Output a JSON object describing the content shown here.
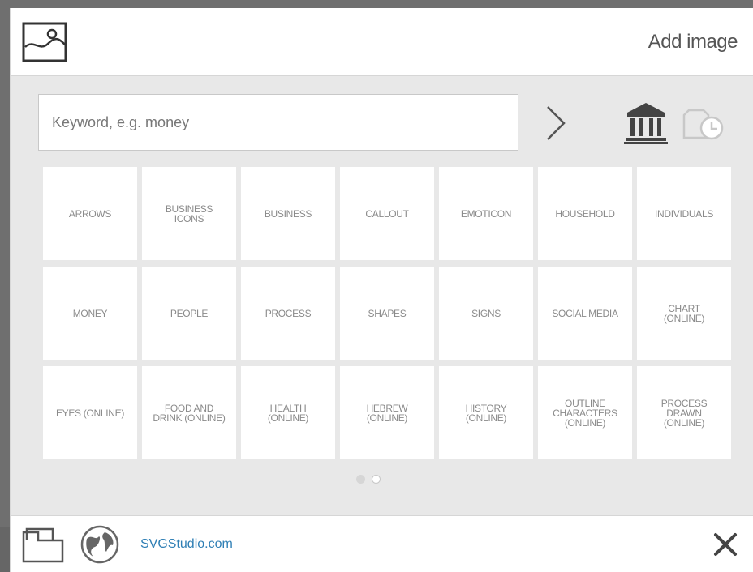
{
  "header": {
    "title": "Add image",
    "image_icon": "image-icon"
  },
  "search": {
    "placeholder": "Keyword, e.g. money",
    "value": ""
  },
  "toolbar": {
    "go_icon": "chevron-right-icon",
    "library_icon": "bank-icon",
    "history_icon": "history-icon"
  },
  "categories": [
    "ARROWS",
    "BUSINESS\nICONS",
    "BUSINESS",
    "CALLOUT",
    "EMOTICON",
    "HOUSEHOLD",
    "INDIVIDUALS",
    "MONEY",
    "PEOPLE",
    "PROCESS",
    "SHAPES",
    "SIGNS",
    "SOCIAL MEDIA",
    "CHART\n(ONLINE)",
    "EYES (ONLINE)",
    "FOOD AND\nDRINK (ONLINE)",
    "HEALTH\n(ONLINE)",
    "HEBREW\n(ONLINE)",
    "HISTORY\n(ONLINE)",
    "OUTLINE\nCHARACTERS\n(ONLINE)",
    "PROCESS\nDRAWN\n(ONLINE)"
  ],
  "pagination": {
    "current": 1,
    "total": 2
  },
  "footer": {
    "link_text": "SVGStudio.com",
    "folder_icon": "folder-icon",
    "globe_icon": "globe-icon",
    "close_icon": "close-icon"
  },
  "colors": {
    "accent_link": "#2f7fb5",
    "panel_bg": "#e8e8e8",
    "tile_bg": "#ffffff"
  }
}
